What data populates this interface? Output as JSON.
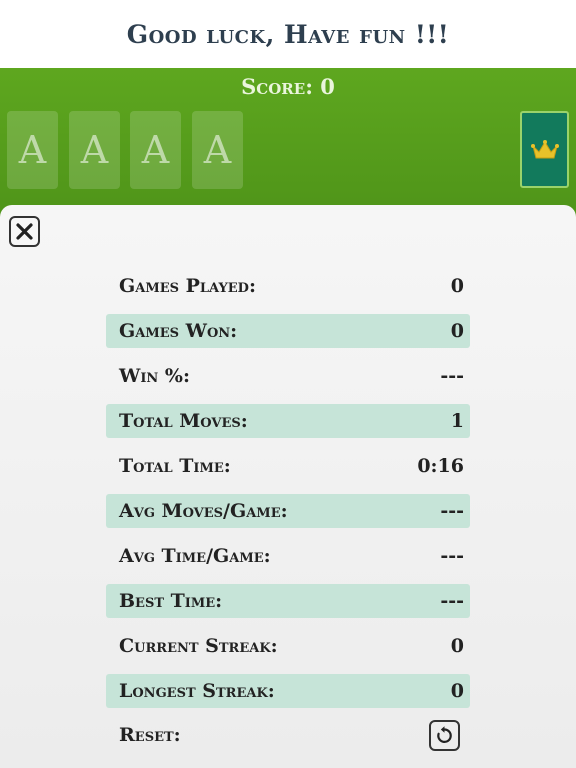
{
  "banner": {
    "message": "Good luck, Have fun !!!"
  },
  "game": {
    "score_text": "Score: 0",
    "foundations": [
      "A",
      "A",
      "A",
      "A"
    ],
    "crown_icon": "crown-icon"
  },
  "colors": {
    "table_green": "#5a9e1f",
    "crown_button": "#127a5c",
    "row_highlight": "#c6e4d8",
    "banner_text": "#2e3f4f"
  },
  "stats": {
    "close_icon": "close-x-icon",
    "rows": [
      {
        "label": "Games Played:",
        "value": "0"
      },
      {
        "label": "Games Won:",
        "value": "0"
      },
      {
        "label": "Win %:",
        "value": "---"
      },
      {
        "label": "Total Moves:",
        "value": "1"
      },
      {
        "label": "Total Time:",
        "value": "0:16"
      },
      {
        "label": "Avg Moves/Game:",
        "value": "---"
      },
      {
        "label": "Avg Time/Game:",
        "value": "---"
      },
      {
        "label": "Best Time:",
        "value": "---"
      },
      {
        "label": "Current Streak:",
        "value": "0"
      },
      {
        "label": "Longest Streak:",
        "value": "0"
      }
    ],
    "reset_label": "Reset:",
    "reset_icon": "reset-icon"
  }
}
